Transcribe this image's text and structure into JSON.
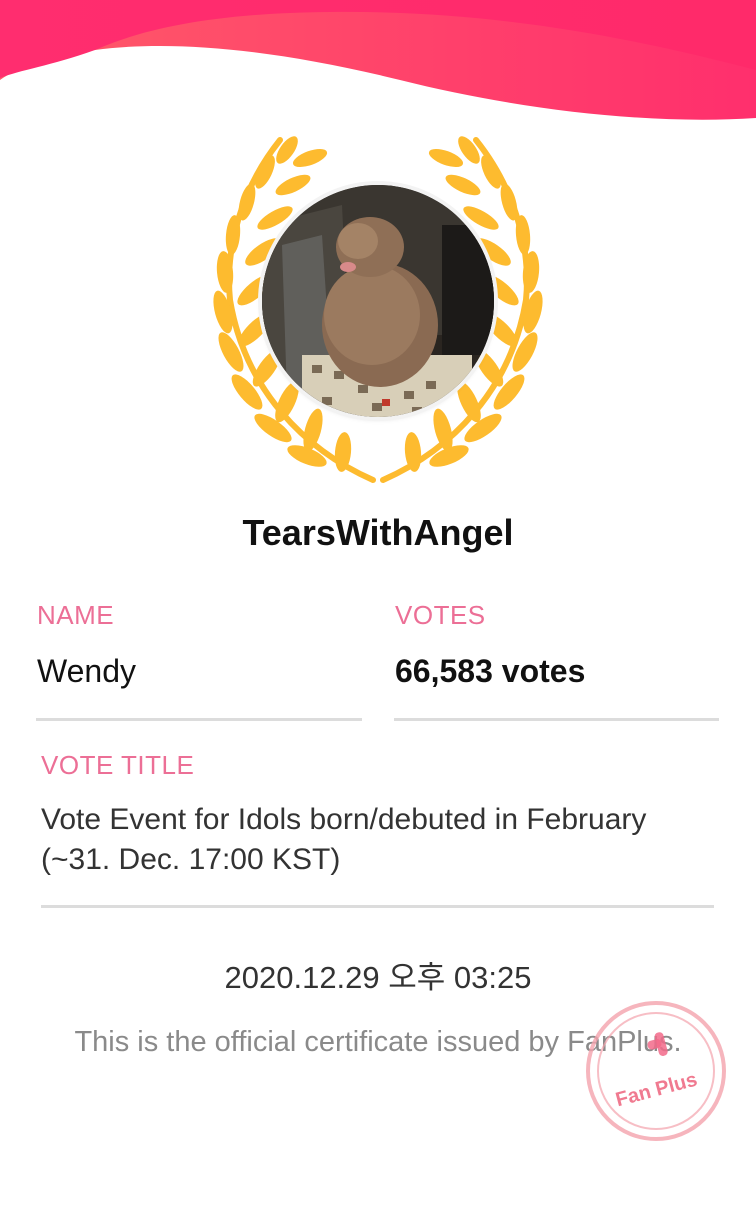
{
  "header": {
    "wave_colors": [
      "#ff2d6f",
      "#ff6a5f"
    ]
  },
  "profile": {
    "username": "TearsWithAngel",
    "avatar_subject": "poodle-photo"
  },
  "fields": {
    "name_label": "NAME",
    "name_value": "Wendy",
    "votes_label": "VOTES",
    "votes_value": "66,583 votes",
    "vote_title_label": "VOTE TITLE",
    "vote_title_value": "Vote Event for Idols born/debuted in February (~31. Dec. 17:00 KST)"
  },
  "issued_at": "2020.12.29 오후 03:25",
  "certificate_note": "This is the official certificate issued by FanPlus.",
  "stamp": {
    "text": "Fan Plus",
    "color": "#f08a9c"
  },
  "colors": {
    "accent": "#ec6f96",
    "wreath": "#fdbb2f"
  }
}
